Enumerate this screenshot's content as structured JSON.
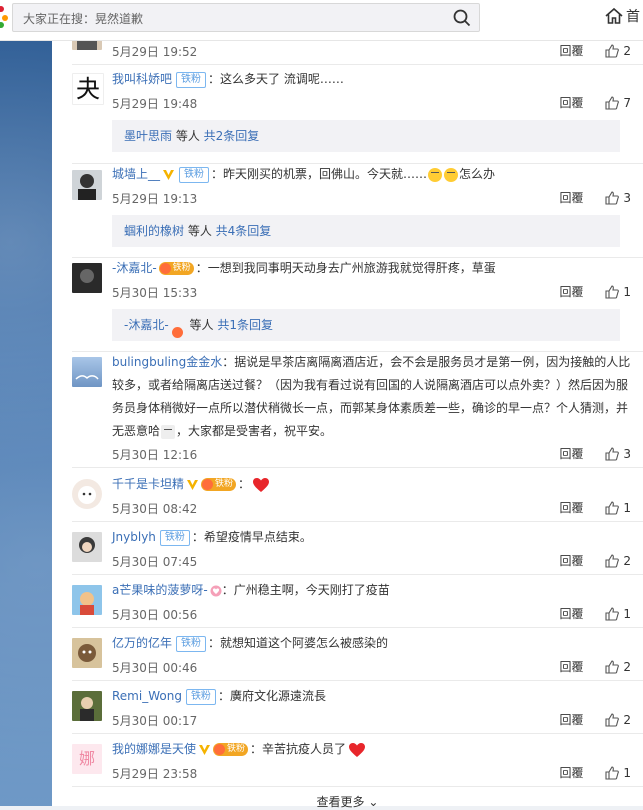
{
  "search": {
    "placeholder": "大家正在搜：晃然道歉"
  },
  "nav": {
    "home_label": "首"
  },
  "comments": [
    {
      "time": "5月29日 19:52",
      "reply": "回覆",
      "likes": "2"
    },
    {
      "user": "我叫科娇吧",
      "fan": "铁粉",
      "text": "：这么多天了 流调呢……",
      "time": "5月29日 19:48",
      "reply": "回覆",
      "likes": "7",
      "sub": {
        "name": "墨叶思雨",
        "etc": " 等人 ",
        "link": "共2条回复"
      }
    },
    {
      "user": "城墙上__",
      "fan": "铁粉",
      "text": "：昨天刚买的机票，回佛山。今天就……",
      "text2": "怎么办",
      "time": "5月29日 19:13",
      "reply": "回覆",
      "likes": "3",
      "sub": {
        "name": "蝈利的橡树",
        "etc": " 等人 ",
        "link": "共4条回复"
      }
    },
    {
      "user": "-沐嘉北-",
      "gold": "铁粉",
      "text": "：一想到我同事明天动身去广州旅游我就觉得肝疼，草蛋",
      "time": "5月30日 15:33",
      "reply": "回覆",
      "likes": "1",
      "sub": {
        "name": "-沐嘉北-",
        "etc": " 等人 ",
        "link": "共1条回复"
      }
    },
    {
      "user": "bulingbuling金金水",
      "line1": "：据说是早茶店离隔离酒店近，会不会是服务员才是第一例，因为接触的人比",
      "line2": "较多，或者给隔离店送过餐？（因为我有看过说有回国的人说隔离酒店可以点外卖？）然后因为服",
      "line3": "务员身体稍微好一点所以潜伏稍微长一点，而郭某身体素质差一些，确诊的早一点？个人猜测，并",
      "line4": "无恶意哈",
      "line4b": "，大家都是受害者，祝平安。",
      "time": "5月30日 12:16",
      "reply": "回覆",
      "likes": "3"
    },
    {
      "user": "千千是卡坦精",
      "gold": "铁粉",
      "text": "：",
      "time": "5月30日 08:42",
      "reply": "回覆",
      "likes": "1"
    },
    {
      "user": "Jnyblyh",
      "fan": "铁粉",
      "text": "：希望疫情早点结束。",
      "time": "5月30日 07:45",
      "reply": "回覆",
      "likes": "2"
    },
    {
      "user": "a芒果味的菠萝呀-",
      "text": "：广州稳主啊，今天刚打了疫苗",
      "time": "5月30日 00:56",
      "reply": "回覆",
      "likes": "1"
    },
    {
      "user": "亿万的亿年",
      "fan": "铁粉",
      "text": "：就想知道这个阿婆怎么被感染的",
      "time": "5月30日 00:46",
      "reply": "回覆",
      "likes": "2"
    },
    {
      "user": "Remi_Wong",
      "fan": "铁粉",
      "text": "：廣府文化源遠流長",
      "time": "5月30日 00:17",
      "reply": "回覆",
      "likes": "2"
    },
    {
      "user": "我的娜娜是天使",
      "gold": "铁粉",
      "text": "：辛苦抗疫人员了",
      "time": "5月29日 23:58",
      "reply": "回覆",
      "likes": "1",
      "avatar_char": "娜"
    }
  ],
  "avatar2_char": "夬",
  "more_label": "查看更多",
  "colors": {
    "link": "#3b6fb6",
    "fan_badge": "#5b9de0",
    "gold_badge": "#f2a623",
    "heart": "#e8262b"
  }
}
